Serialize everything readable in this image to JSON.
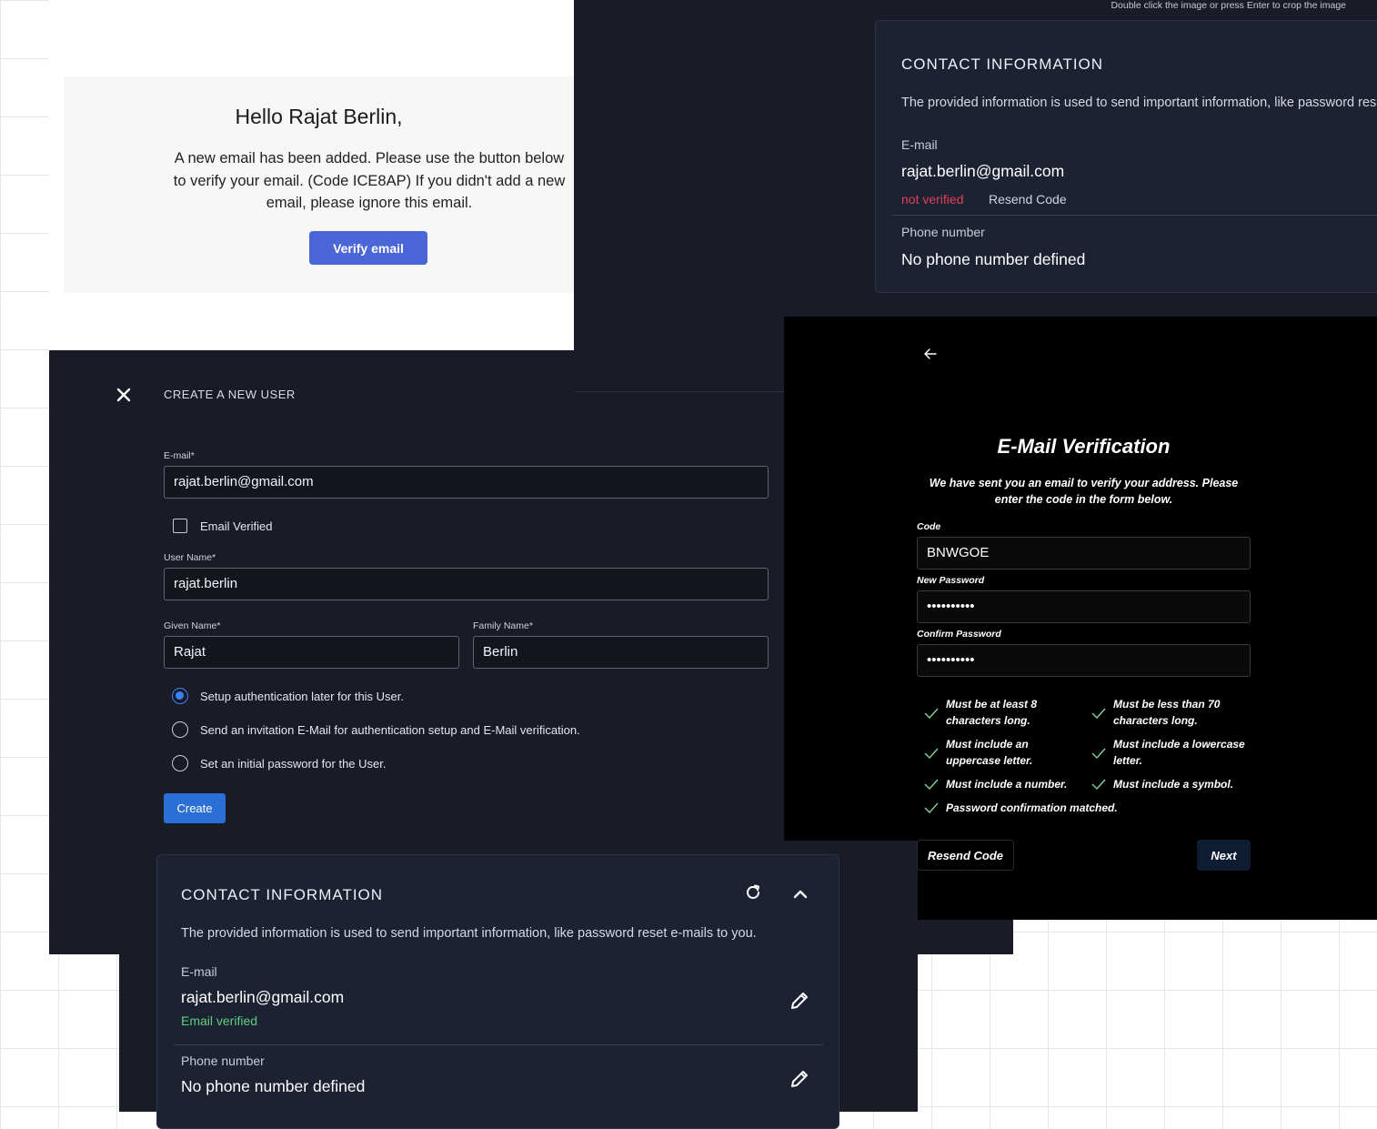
{
  "crop_hint": "Double click the image or press Enter to crop the image",
  "email_card": {
    "greeting": "Hello Rajat Berlin,",
    "body": "A new email has been added. Please use the button below to verify your email. (Code ICE8AP) If you didn't add a new email, please ignore this email.",
    "button": "Verify email"
  },
  "create_user": {
    "title": "CREATE A NEW USER",
    "email_label": "E-mail*",
    "email_value": "rajat.berlin@gmail.com",
    "email_verified_label": "Email Verified",
    "email_verified_checked": false,
    "username_label": "User Name*",
    "username_value": "rajat.berlin",
    "given_name_label": "Given Name*",
    "given_name_value": "Rajat",
    "family_name_label": "Family Name*",
    "family_name_value": "Berlin",
    "auth_options": [
      {
        "label": "Setup authentication later for this User.",
        "selected": true
      },
      {
        "label": "Send an invitation E-Mail for authentication setup and E-Mail verification.",
        "selected": false
      },
      {
        "label": "Set an initial password for the User.",
        "selected": false
      }
    ],
    "create_button": "Create"
  },
  "contact_top": {
    "title": "CONTACT INFORMATION",
    "description": "The provided information is used to send important information, like password reset e-mails to you.",
    "email_label": "E-mail",
    "email_value": "rajat.berlin@gmail.com",
    "status": "not verified",
    "resend": "Resend Code",
    "phone_label": "Phone number",
    "phone_value": "No phone number defined"
  },
  "verification": {
    "title": "E-Mail Verification",
    "description": "We have sent you an email to verify your address. Please enter the code in the form below.",
    "code_label": "Code",
    "code_value": "BNWGOE",
    "new_password_label": "New Password",
    "new_password_value": "••••••••••",
    "confirm_password_label": "Confirm Password",
    "confirm_password_value": "••••••••••",
    "requirements": [
      "Must be at least 8 characters long.",
      "Must be less than 70 characters long.",
      "Must include an uppercase letter.",
      "Must include a lowercase letter.",
      "Must include a number.",
      "Must include a symbol.",
      "Password confirmation matched."
    ],
    "resend_button": "Resend Code",
    "next_button": "Next",
    "check_color": "#7ed49a"
  },
  "contact_bottom": {
    "title": "CONTACT INFORMATION",
    "description": "The provided information is used to send important information, like password reset e-mails to you.",
    "email_label": "E-mail",
    "email_value": "rajat.berlin@gmail.com",
    "status": "Email verified",
    "phone_label": "Phone number",
    "phone_value": "No phone number defined"
  }
}
